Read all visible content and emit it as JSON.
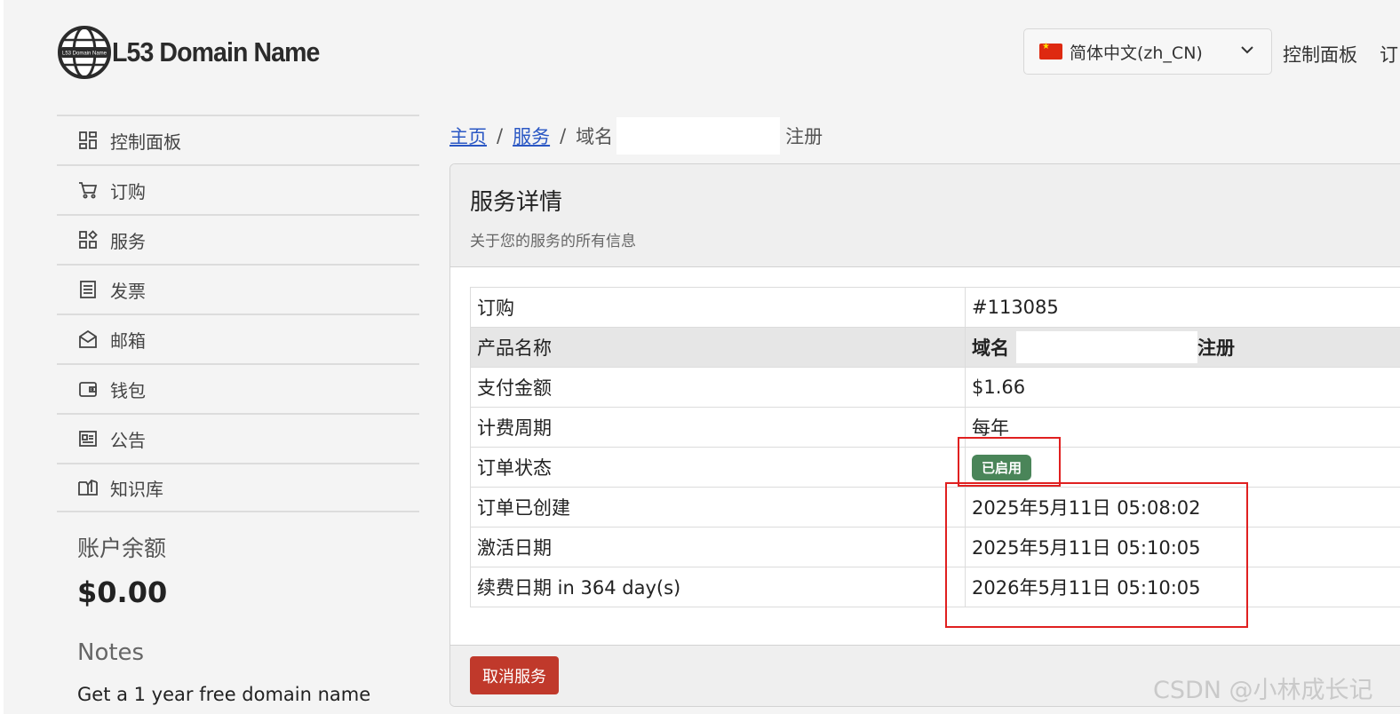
{
  "header": {
    "logo_text": "L53 Domain Name",
    "logo_badge_text": "L53 Domain Name",
    "language": {
      "selected": "简体中文(zh_CN)",
      "flag": "cn-flag-icon"
    },
    "links": [
      "控制面板",
      "订"
    ]
  },
  "sidebar": {
    "items": [
      {
        "label": "控制面板",
        "icon": "dashboard-icon"
      },
      {
        "label": "订购",
        "icon": "cart-icon"
      },
      {
        "label": "服务",
        "icon": "services-icon"
      },
      {
        "label": "发票",
        "icon": "invoice-icon"
      },
      {
        "label": "邮箱",
        "icon": "mail-icon"
      },
      {
        "label": "钱包",
        "icon": "wallet-icon"
      },
      {
        "label": "公告",
        "icon": "news-icon"
      },
      {
        "label": "知识库",
        "icon": "book-icon"
      }
    ],
    "balance_title": "账户余额",
    "balance_value": "$0.00",
    "notes_title": "Notes",
    "notes_text": "Get a 1 year free domain name"
  },
  "breadcrumb": {
    "home": "主页",
    "services": "服务",
    "current_prefix": "域名",
    "current_suffix": "注册"
  },
  "card": {
    "title": "服务详情",
    "subtitle": "关于您的服务的所有信息",
    "rows": [
      {
        "label": "订购",
        "value": "#113085"
      },
      {
        "label": "产品名称",
        "value_prefix": "域名",
        "value_suffix": "注册"
      },
      {
        "label": "支付金额",
        "value": "$1.66"
      },
      {
        "label": "计费周期",
        "value": "每年"
      },
      {
        "label": "订单状态",
        "badge": "已启用"
      },
      {
        "label": "订单已创建",
        "value": "2025年5月11日 05:08:02"
      },
      {
        "label": "激活日期",
        "value": "2025年5月11日 05:10:05"
      },
      {
        "label": "续费日期 in 364 day(s)",
        "value": "2026年5月11日 05:10:05"
      }
    ],
    "cancel_button": "取消服务"
  },
  "colors": {
    "link": "#2a57c4",
    "badge_active": "#4a8559",
    "cancel_button": "#c0392b",
    "annotation": "#e02020"
  },
  "watermark": "CSDN @小林成长记"
}
